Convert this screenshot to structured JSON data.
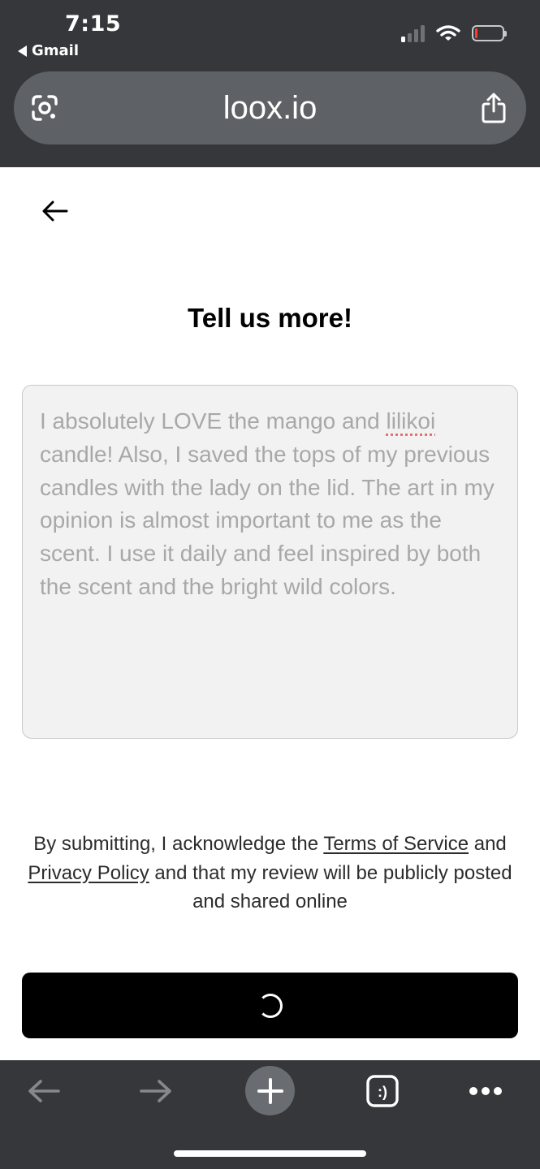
{
  "status_bar": {
    "time": "7:15",
    "back_app_label": "Gmail"
  },
  "browser": {
    "url": "loox.io",
    "icons": {
      "lens": "google-lens-icon",
      "share": "share-icon",
      "back": "back-arrow-icon",
      "forward": "forward-arrow-icon",
      "new_tab": "plus-icon",
      "tabs": "tab-switcher-icon",
      "menu": "more-icon"
    },
    "tab_switcher_label": ":)"
  },
  "form": {
    "title": "Tell us more!",
    "review_text_before": "I absolutely LOVE the mango and ",
    "review_text_misspelled": "lilikoi",
    "review_text_after": " candle! Also, I saved the tops of my previous candles with the lady on the lid. The art in my opinion is almost important to me as the scent. I use it daily and feel inspired by both the scent and the bright wild colors.",
    "legal_prefix": "By submitting, I acknowledge the ",
    "terms_link": "Terms of Service",
    "legal_middle": " and ",
    "privacy_link": "Privacy Policy",
    "legal_suffix": " and that my review will be publicly posted and shared online"
  },
  "colors": {
    "chrome": "#35373b",
    "url_bar": "#5e6166",
    "submit_button": "#000000",
    "battery_low": "#ff3b30"
  }
}
